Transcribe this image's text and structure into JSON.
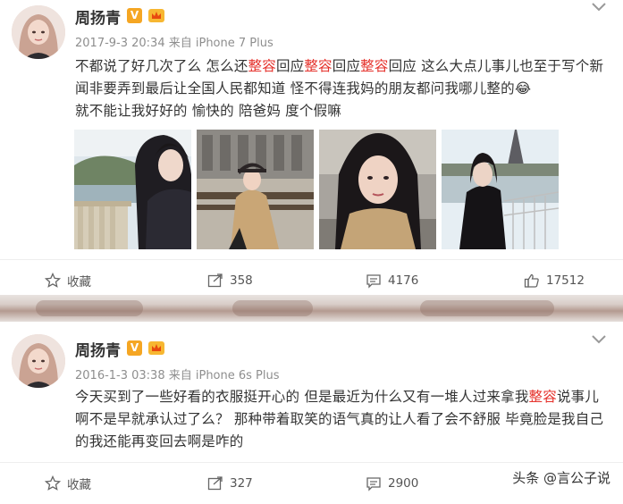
{
  "posts": [
    {
      "username": "周扬青",
      "verified_badge": "V",
      "meta": "2017-9-3 20:34 来自 iPhone 7 Plus",
      "content": [
        {
          "t": "不都说了好几次了么 怎么还",
          "hl": false
        },
        {
          "t": "整容",
          "hl": true
        },
        {
          "t": "回应",
          "hl": false
        },
        {
          "t": "整容",
          "hl": true
        },
        {
          "t": "回应",
          "hl": false
        },
        {
          "t": "整容",
          "hl": true
        },
        {
          "t": "回应 这么大点儿事儿也至于写个新闻非要弄到最后让全国人民都知道 怪不得连我妈的朋友都问我哪儿整的",
          "hl": false
        },
        {
          "t": "😂",
          "hl": false
        },
        {
          "t": "就不能让我好好的 愉快的 陪爸妈 度个假嘛",
          "hl": false
        }
      ],
      "actions": {
        "favorite": "收藏",
        "repost": "358",
        "comment": "4176",
        "like": "17512"
      }
    },
    {
      "username": "周扬青",
      "verified_badge": "V",
      "meta": "2016-1-3 03:38 来自 iPhone 6s Plus",
      "content": [
        {
          "t": "今天买到了一些好看的衣服挺开心的 但是最近为什么又有一堆人过来拿我",
          "hl": false
        },
        {
          "t": "整容",
          "hl": true
        },
        {
          "t": "说事儿 啊不是早就承认过了么？ 那种带着取笑的语气真的让人看了会不舒服 毕竟脸是我自己的我还能再变回去啊是咋的",
          "hl": false
        }
      ],
      "actions": {
        "favorite": "收藏",
        "repost": "327",
        "comment": "2900"
      }
    }
  ],
  "watermark": "头条 @言公子说",
  "colors": {
    "highlight": "#e5312b",
    "badge": "#f5a623",
    "meta": "#8e8e8e"
  }
}
